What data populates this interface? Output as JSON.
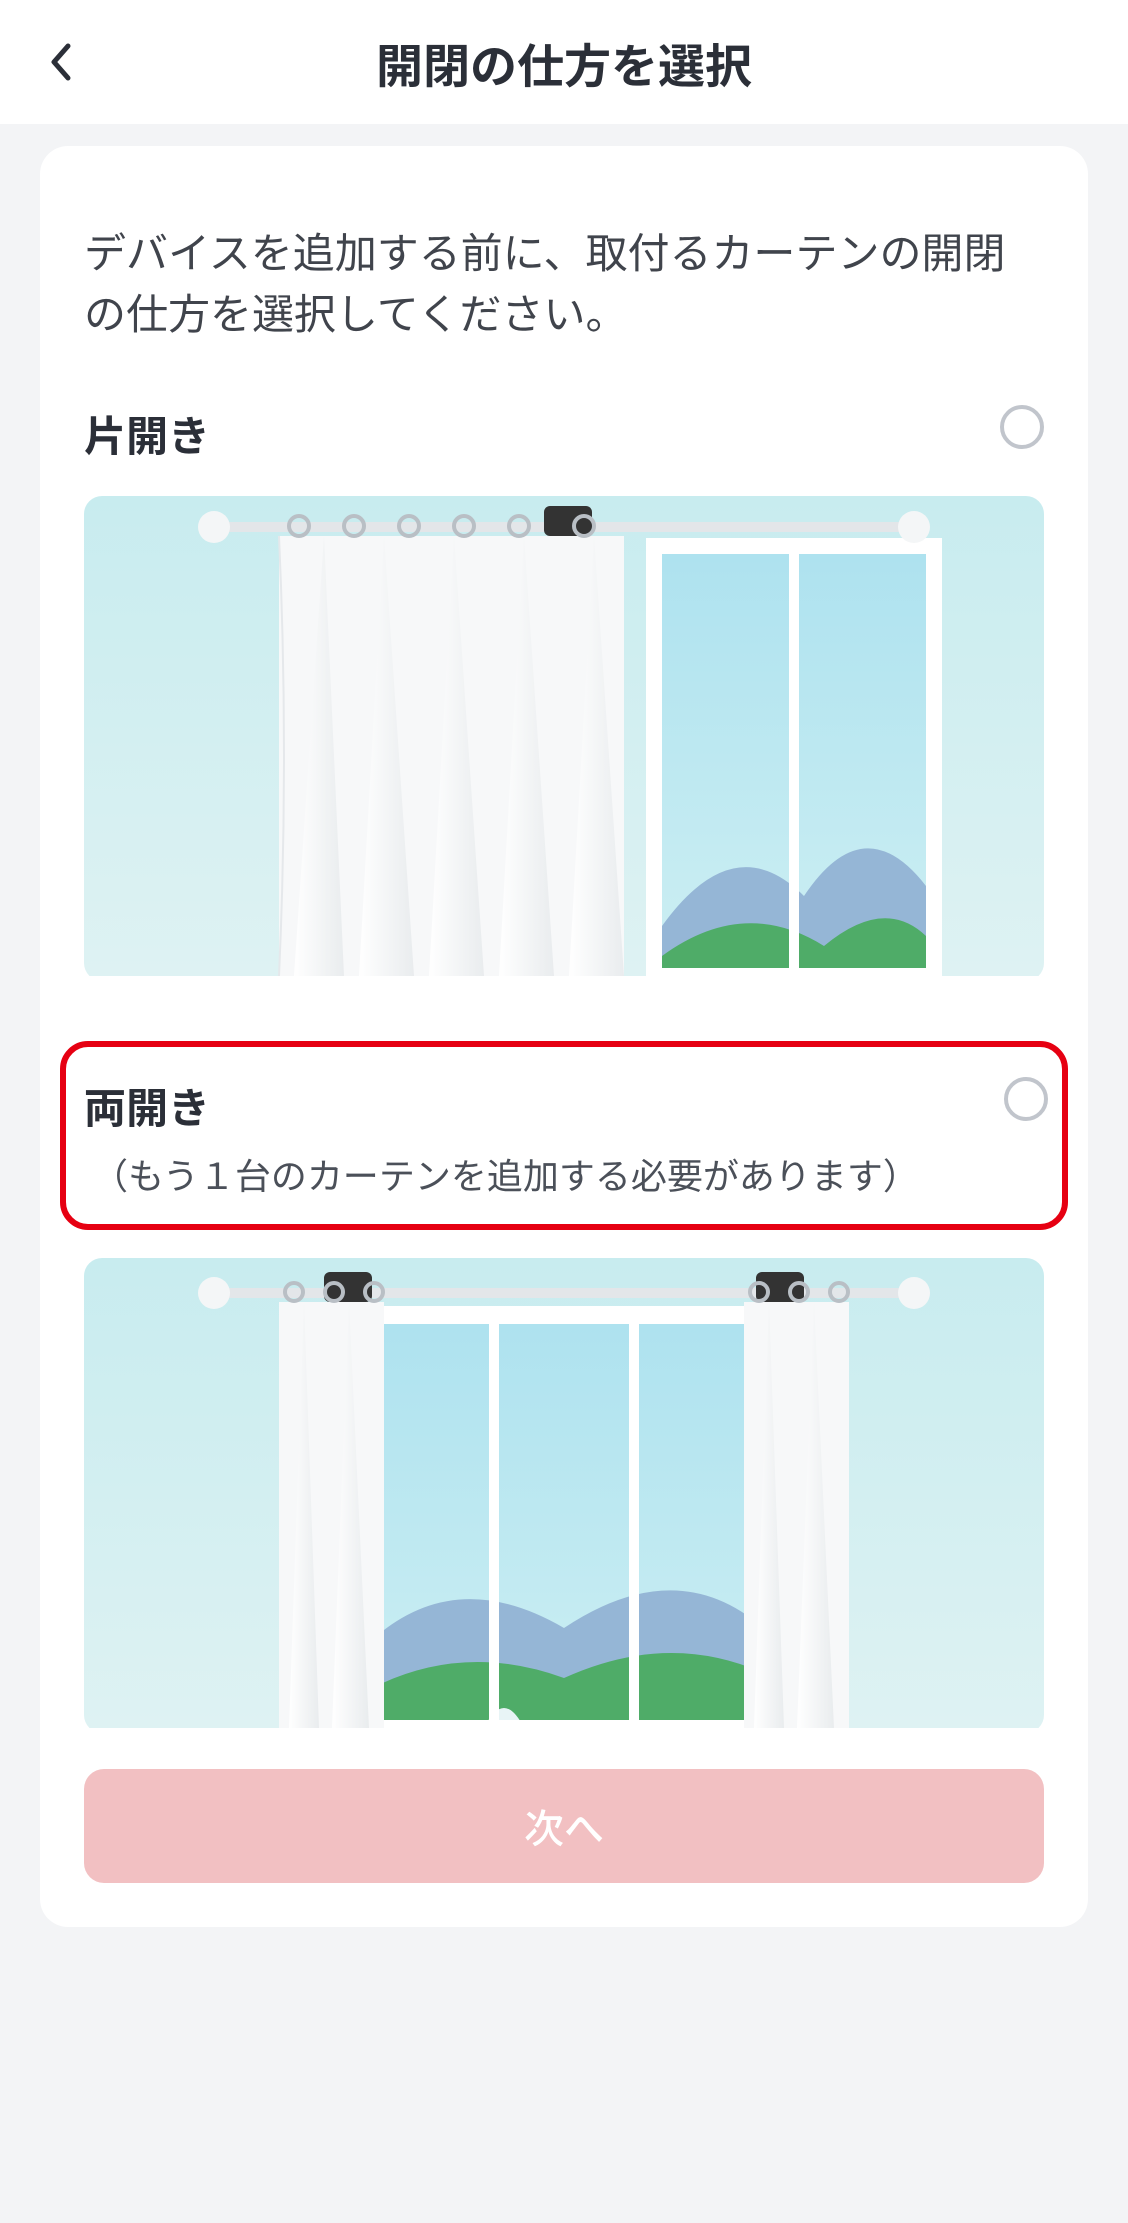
{
  "header": {
    "title": "開閉の仕方を選択"
  },
  "instruction": "デバイスを追加する前に、取付るカーテンの開閉の仕方を選択してください。",
  "options": [
    {
      "label": "片開き",
      "selected": false
    },
    {
      "label": "両開き",
      "sub": "（もう１台のカーテンを追加する必要があります）",
      "selected": false,
      "highlighted": true
    }
  ],
  "next_label": "次へ",
  "colors": {
    "highlight_border": "#e60012",
    "button_bg": "#f2c0c2"
  }
}
